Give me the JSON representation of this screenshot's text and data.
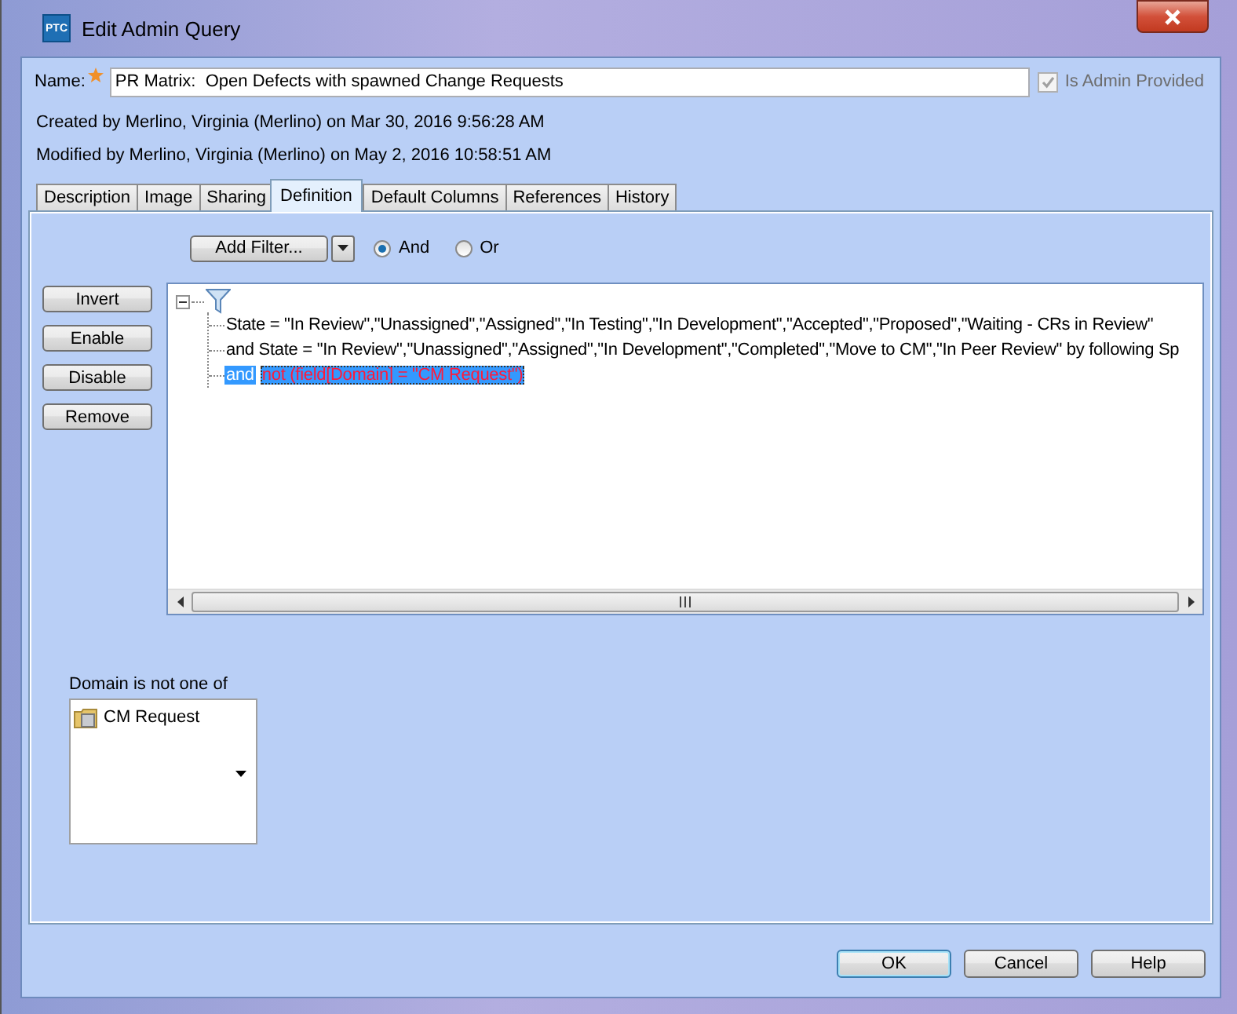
{
  "window": {
    "title": "Edit Admin Query",
    "app_badge": "PTC"
  },
  "name_field": {
    "label": "Name:",
    "value": "PR Matrix:  Open Defects with spawned Change Requests",
    "required": true
  },
  "is_admin_provided": {
    "label": "Is Admin Provided",
    "checked": true,
    "disabled": true
  },
  "created": "Created by Merlino, Virginia (Merlino) on Mar 30, 2016 9:56:28 AM",
  "modified": "Modified by Merlino, Virginia (Merlino) on May 2, 2016 10:58:51 AM",
  "tabs": [
    {
      "label": "Description",
      "selected": false
    },
    {
      "label": "Image",
      "selected": false
    },
    {
      "label": "Sharing",
      "selected": false
    },
    {
      "label": "Definition",
      "selected": true
    },
    {
      "label": "Default Columns",
      "selected": false
    },
    {
      "label": "References",
      "selected": false
    },
    {
      "label": "History",
      "selected": false
    }
  ],
  "definition": {
    "add_filter": "Add Filter...",
    "combine": [
      {
        "label": "And",
        "selected": true
      },
      {
        "label": "Or",
        "selected": false
      }
    ],
    "actions": [
      "Invert",
      "Enable",
      "Disable",
      "Remove"
    ],
    "tree": {
      "expanded": true,
      "children": [
        {
          "text": "State = \"In Review\",\"Unassigned\",\"Assigned\",\"In Testing\",\"In Development\",\"Accepted\",\"Proposed\",\"Waiting - CRs in Review\"",
          "selected": false,
          "negated": false
        },
        {
          "text": "and State = \"In Review\",\"Unassigned\",\"Assigned\",\"In Development\",\"Completed\",\"Move to CM\",\"In Peer Review\" by following Sp",
          "selected": false,
          "negated": false
        },
        {
          "conjunction": "and",
          "text": "not (field[Domain] = \"CM Request\")",
          "selected": true,
          "negated": true
        }
      ]
    },
    "detail": {
      "heading": "Domain is not one of",
      "values": [
        "CM Request"
      ]
    }
  },
  "buttons": [
    {
      "label": "OK",
      "default": true
    },
    {
      "label": "Cancel",
      "default": false
    },
    {
      "label": "Help",
      "default": false
    }
  ]
}
